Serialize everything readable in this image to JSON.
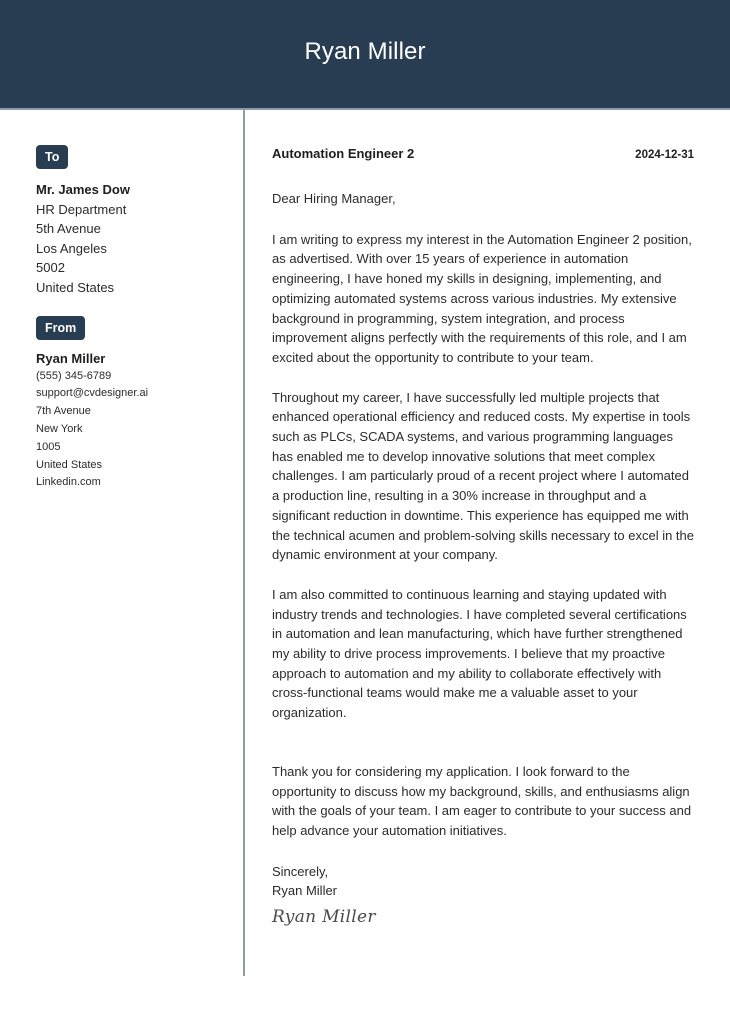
{
  "header": {
    "name": "Ryan Miller"
  },
  "colors": {
    "header_bg": "#283c52",
    "divider": "#8f9aa7",
    "badge_bg": "#283c52"
  },
  "recipient": {
    "badge_label": "To",
    "name": "Mr. James Dow",
    "lines": [
      "HR Department",
      "5th Avenue",
      "Los Angeles",
      "5002",
      "United States"
    ]
  },
  "sender": {
    "badge_label": "From",
    "name": "Ryan Miller",
    "lines": [
      "(555) 345-6789",
      "support@cvdesigner.ai",
      "7th Avenue",
      "New York",
      "1005",
      "United States",
      "Linkedin.com"
    ]
  },
  "letter": {
    "job_title": "Automation Engineer 2",
    "date": "2024-12-31",
    "salutation": "Dear Hiring Manager,",
    "paragraphs": [
      "I am writing to express my interest in the Automation Engineer 2 position, as advertised. With over 15 years of experience in automation engineering, I have honed my skills in designing, implementing, and optimizing automated systems across various industries. My extensive background in programming, system integration, and process improvement aligns perfectly with the requirements of this role, and I am excited about the opportunity to contribute to your team.",
      "Throughout my career, I have successfully led multiple projects that enhanced operational efficiency and reduced costs. My expertise in tools such as PLCs, SCADA systems, and various programming languages has enabled me to develop innovative solutions that meet complex challenges. I am particularly proud of a recent project where I automated a production line, resulting in a 30% increase in throughput and a significant reduction in downtime. This experience has equipped me with the technical acumen and problem-solving skills necessary to excel in the dynamic environment at your company.",
      "I am also committed to continuous learning and staying updated with industry trends and technologies. I have completed several certifications in automation and lean manufacturing, which have further strengthened my ability to drive process improvements. I believe that my proactive approach to automation and my ability to collaborate effectively with cross-functional teams would make me a valuable asset to your organization.",
      "Thank you for considering my application. I look forward to the opportunity to discuss how my background, skills, and enthusiasms align with the goals of your team. I am eager to contribute to your success and help advance your automation initiatives."
    ],
    "closing": "Sincerely,",
    "closing_name": "Ryan Miller",
    "signature": "Ryan Miller"
  }
}
